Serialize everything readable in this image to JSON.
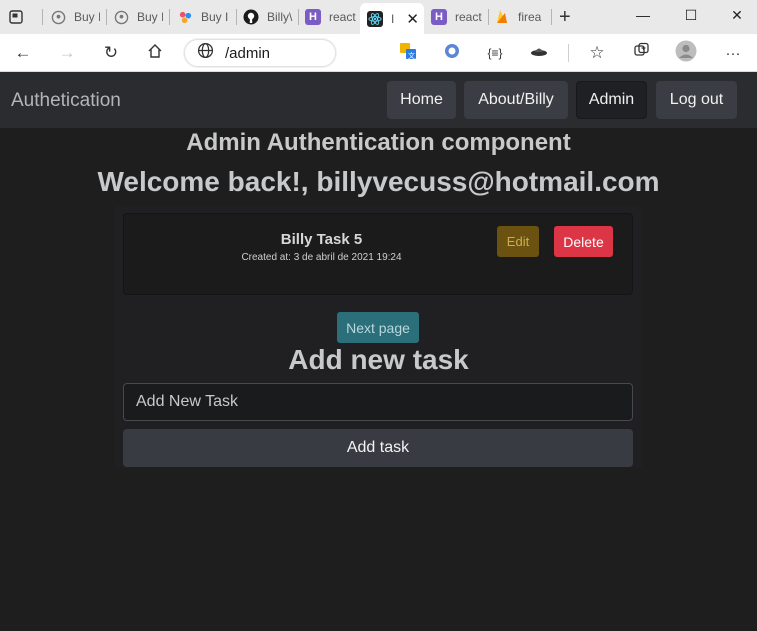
{
  "browser": {
    "tabs": [
      {
        "label": "",
        "icon": "tab-actions-icon"
      },
      {
        "label": "Buy I",
        "icon": "shield-pin-icon"
      },
      {
        "label": "Buy I",
        "icon": "shield-pin-icon"
      },
      {
        "label": "Buy I",
        "icon": "pinwheel-icon"
      },
      {
        "label": "Billy\\",
        "icon": "github-icon"
      },
      {
        "label": "react",
        "icon": "heroku-icon"
      },
      {
        "label": "I",
        "icon": "react-icon"
      },
      {
        "label": "react",
        "icon": "heroku-icon"
      },
      {
        "label": "firea",
        "icon": "firebase-icon"
      }
    ],
    "url": "/admin"
  },
  "nav": {
    "brand": "Authetication",
    "home": "Home",
    "about": "About/Billy",
    "admin": "Admin",
    "logout": "Log out"
  },
  "main": {
    "heading": "Admin Authentication component",
    "welcome": "Welcome back!, billyvecuss@hotmail.com",
    "task": {
      "title": "Billy Task 5",
      "created": "Created at: 3 de abril de 2021 19:24",
      "edit_label": "Edit",
      "delete_label": "Delete"
    },
    "next_page_label": "Next page",
    "add_heading": "Add new task",
    "input_placeholder": "Add New Task",
    "add_button_label": "Add task"
  },
  "colors": {
    "page_bg": "#1e1e1f",
    "navbar_bg": "#2b2c30",
    "delete": "#dc3545",
    "edit": "#6b5210",
    "next": "#2a6f7a"
  }
}
